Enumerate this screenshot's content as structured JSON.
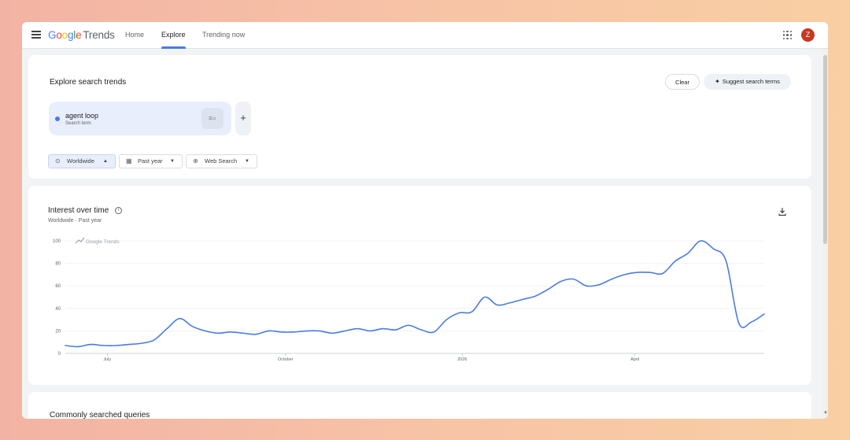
{
  "app": {
    "logo_google": [
      "G",
      "o",
      "o",
      "g",
      "l",
      "e"
    ],
    "logo_trends": "Trends",
    "nav": {
      "home": "Home",
      "explore": "Explore",
      "trending": "Trending now"
    },
    "avatar_initial": "Z",
    "apps_icon": "apps-grid-icon",
    "menu_icon": "hamburger-menu-icon"
  },
  "explore": {
    "title": "Explore search trends",
    "clear_label": "Clear",
    "suggest_label": "Suggest search terms",
    "term": {
      "name": "agent loop",
      "type": "Search term",
      "color": "#4a7be0"
    },
    "add_label": "+",
    "filters": {
      "region": "Worldwide",
      "time": "Past year",
      "property": "Web Search"
    }
  },
  "interest": {
    "title": "Interest over time",
    "subtitle": "Worldwide · Past year",
    "watermark": "Google Trends"
  },
  "bottom_title": "Commonly searched queries",
  "chart_data": {
    "type": "line",
    "title": "Interest over time",
    "ylim": [
      0,
      100
    ],
    "yticks": [
      "0",
      "20",
      "40",
      "60",
      "80",
      "100"
    ],
    "xticks": [
      "July",
      "October",
      "2026",
      "April"
    ],
    "grid": true,
    "color": "#4a7be0",
    "series": [
      {
        "name": "agent loop",
        "values": [
          7,
          6,
          8,
          7,
          7,
          8,
          9,
          12,
          22,
          31,
          24,
          20,
          18,
          19,
          18,
          17,
          20,
          19,
          19,
          20,
          20,
          18,
          20,
          22,
          20,
          22,
          21,
          25,
          21,
          19,
          30,
          36,
          37,
          50,
          43,
          45,
          48,
          51,
          57,
          64,
          66,
          60,
          61,
          66,
          70,
          72,
          72,
          71,
          82,
          89,
          100,
          93,
          82,
          27,
          28,
          35
        ]
      }
    ]
  }
}
